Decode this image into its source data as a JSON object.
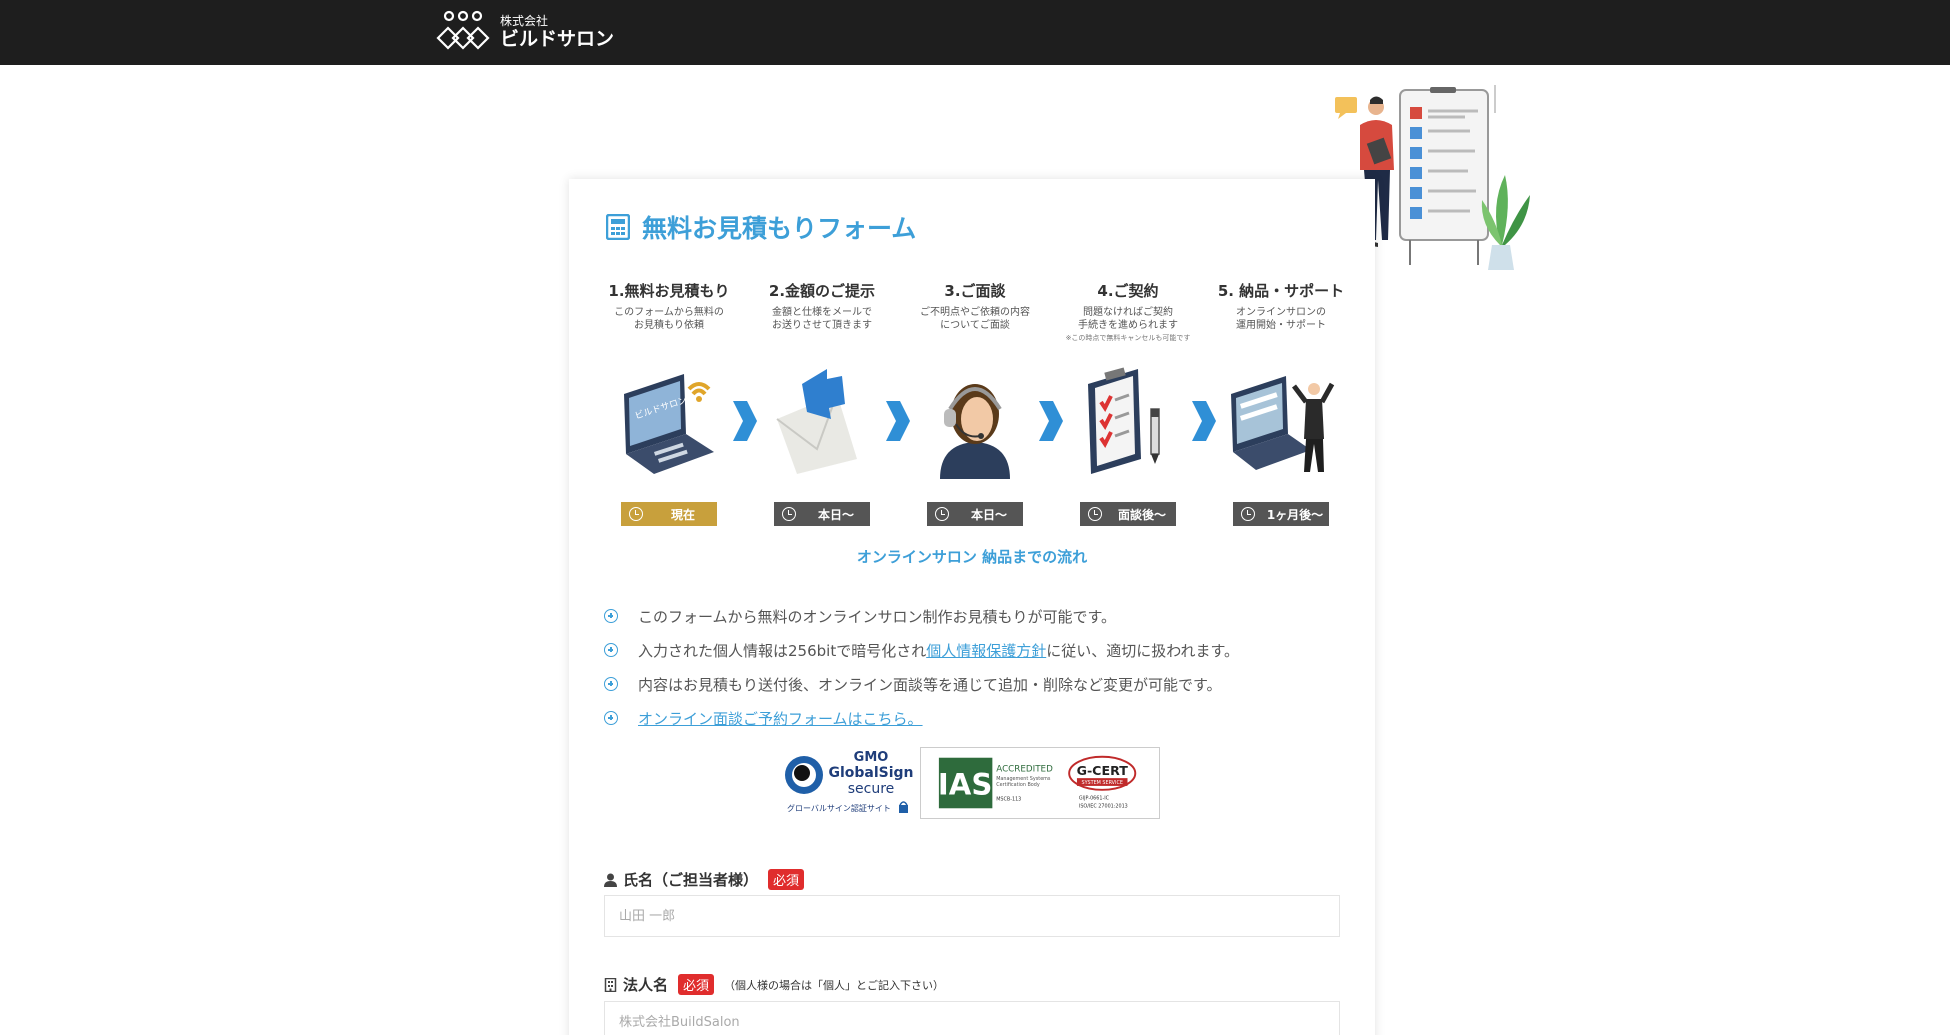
{
  "header": {
    "logo_small": "株式会社",
    "logo_big": "ビルドサロン",
    "bg_color": "#1e1e1e"
  },
  "form": {
    "title": "無料お見積もりフォーム",
    "accent_color": "#3d9fd8"
  },
  "steps": [
    {
      "title": "1.無料お見積もり",
      "desc": "このフォームから無料の\nお見積もり依頼",
      "note": "",
      "badge": "現在",
      "icon": "laptop-form-icon",
      "current": true
    },
    {
      "title": "2.金額のご提示",
      "desc": "金額と仕様をメールで\nお送りさせて頂きます",
      "note": "",
      "badge": "本日〜",
      "icon": "envelope-icon",
      "current": false
    },
    {
      "title": "3.ご面談",
      "desc": "ご不明点やご依頼の内容\nについてご面談",
      "note": "",
      "badge": "本日〜",
      "icon": "operator-headset-icon",
      "current": false
    },
    {
      "title": "4.ご契約",
      "desc": "問題なければご契約\n手続きを進められます",
      "note": "※この時点で無料キャンセルも可能です",
      "badge": "面談後〜",
      "icon": "clipboard-checklist-icon",
      "current": false
    },
    {
      "title": "5. 納品・サポート",
      "desc": "オンラインサロンの\n運用開始・サポート",
      "note": "",
      "badge": "1ヶ月後〜",
      "icon": "laptop-success-icon",
      "current": false
    }
  ],
  "flow_caption": "オンラインサロン 納品までの流れ",
  "notes": {
    "n1": "このフォームから無料のオンラインサロン制作お見積もりが可能です。",
    "n2_before": "入力された個人情報は256bitで暗号化され",
    "n2_link": "個人情報保護方針",
    "n2_after": "に従い、適切に扱われます。",
    "n3": "内容はお見積もり送付後、オンライン面談等を通じて追加・削除など変更が可能です。",
    "n4_link": "オンライン面談ご予約フォームはこちら。"
  },
  "certs": {
    "gmo_line1": "GMO",
    "gmo_line2": "GlobalSign",
    "gmo_line3": "secure",
    "gmo_caption": "グローバルサイン認証サイト",
    "ias_mark": "IAS",
    "ias_accredited": "ACCREDITED",
    "ias_sub1": "Management Systems",
    "ias_sub2": "Certification Body",
    "ias_code": "MSCB-113",
    "gcert_mark": "G-CERT",
    "gcert_service": "SYSTEM SERVICE",
    "gcert_code": "GIJP-0661-IC",
    "gcert_std": "ISO/IEC 27001:2013"
  },
  "fields": {
    "name_label": "氏名（ご担当者様）",
    "name_required": "必須",
    "name_placeholder": "山田 一郎",
    "company_label": "法人名",
    "company_required": "必須",
    "company_hint": "（個人様の場合は「個人」とご記入下さい）",
    "company_placeholder": "株式会社BuildSalon"
  }
}
